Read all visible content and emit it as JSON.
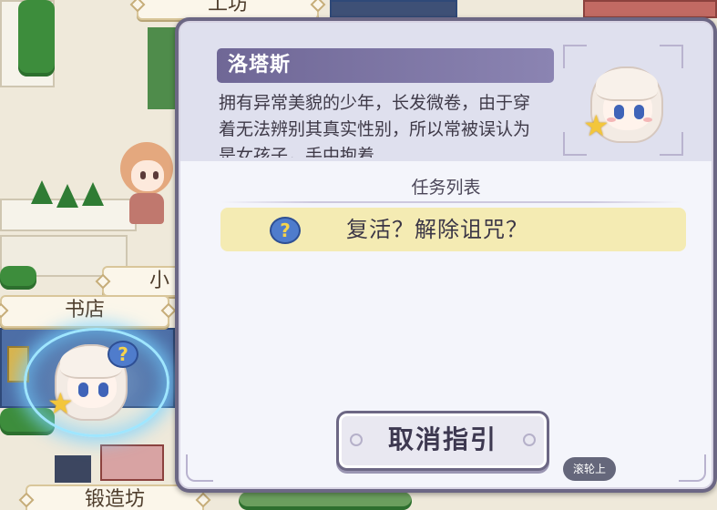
{
  "map": {
    "labels": {
      "workshop": "工坊",
      "small": "小",
      "bookstore": "书店",
      "forge": "锻造坊"
    }
  },
  "dialog": {
    "character_name": "洛塔斯",
    "description": "拥有异常美貌的少年，长发微卷，由于穿着无法辨别其真实性别，所以常被误认为是女孩子，手中抱着",
    "task_list_title": "任务列表",
    "quests": [
      {
        "label": "复活？解除诅咒？",
        "icon": "question-bubble-icon"
      }
    ],
    "cancel_label": "取消指引"
  },
  "toast": {
    "text": "滚轮上"
  },
  "icons": {
    "question_glyph": "?",
    "star_glyph": "★"
  },
  "colors": {
    "dialog_frame": "#6c6784",
    "name_banner": "#766e9f",
    "quest_highlight": "#f4ebb3",
    "focus_glow": "#9fe6ff"
  }
}
